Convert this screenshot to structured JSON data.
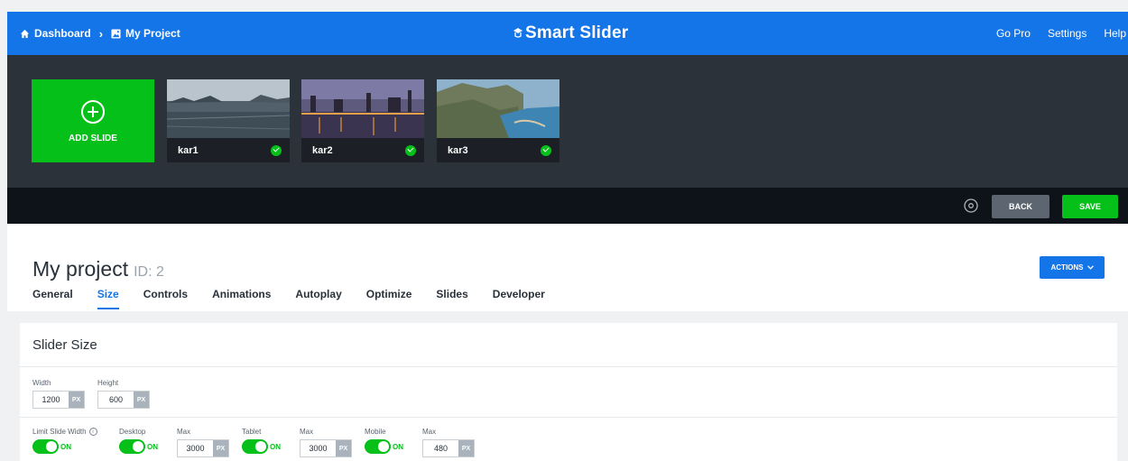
{
  "topbar": {
    "breadcrumb": {
      "dashboard": "Dashboard",
      "project": "My Project"
    },
    "brand": "Smart Slider",
    "nav": [
      "Go Pro",
      "Settings",
      "Help"
    ]
  },
  "slides": {
    "add_label": "ADD SLIDE",
    "items": [
      {
        "name": "kar1"
      },
      {
        "name": "kar2"
      },
      {
        "name": "kar3"
      }
    ]
  },
  "actionbar": {
    "back": "BACK",
    "save": "SAVE"
  },
  "project": {
    "title": "My project",
    "id_label": "ID: 2",
    "actions": "ACTIONS",
    "tabs": [
      "General",
      "Size",
      "Controls",
      "Animations",
      "Autoplay",
      "Optimize",
      "Slides",
      "Developer"
    ],
    "active_tab": "Size"
  },
  "panel": {
    "title": "Slider Size",
    "width": {
      "label": "Width",
      "value": "1200",
      "unit": "PX"
    },
    "height": {
      "label": "Height",
      "value": "600",
      "unit": "PX"
    },
    "limit": {
      "label": "Limit Slide Width",
      "state": "ON"
    },
    "desktop": {
      "label": "Desktop",
      "state": "ON",
      "max_label": "Max",
      "max": "3000",
      "unit": "PX"
    },
    "tablet": {
      "label": "Tablet",
      "state": "ON",
      "max_label": "Max",
      "max": "3000",
      "unit": "PX"
    },
    "mobile": {
      "label": "Mobile",
      "state": "ON",
      "max_label": "Max",
      "max": "480",
      "unit": "PX"
    }
  },
  "colors": {
    "primary": "#1375e8",
    "green": "#04c018",
    "dark": "#2c3239",
    "darker": "#0e1319"
  }
}
